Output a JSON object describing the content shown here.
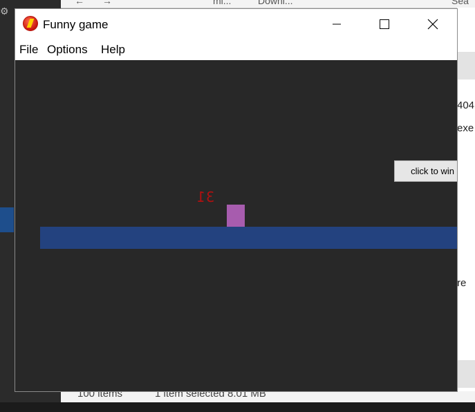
{
  "background": {
    "address_parts": [
      "mi...",
      "Downl..."
    ],
    "search_placeholder": "Sea",
    "right_fragments": [
      "404",
      "exe",
      "re"
    ],
    "status_items": "100 items",
    "status_selected": "1 item selected  8.01 MB"
  },
  "window": {
    "title": "Funny game",
    "icon": "flash-red-circle-icon",
    "controls": [
      "minimize-icon",
      "maximize-icon",
      "close-icon"
    ]
  },
  "menu": [
    "File",
    "Options",
    "Help"
  ],
  "game": {
    "score_text": "31",
    "win_button_label": "click to win",
    "colors": {
      "canvas": "#282828",
      "platform": "#23427f",
      "player": "#a75cae",
      "score": "#b01010"
    }
  }
}
